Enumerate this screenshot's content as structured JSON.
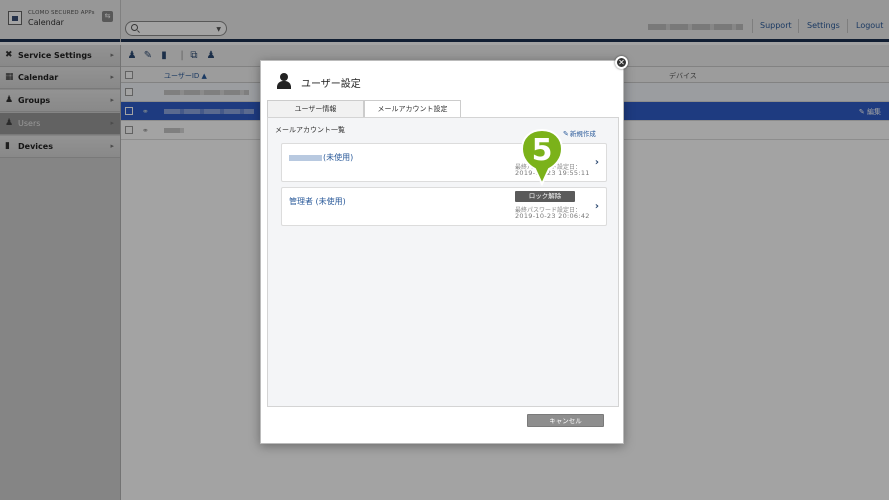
{
  "app": {
    "brand_sub": "CLOMO SECURED APPs",
    "brand_title": "Calendar",
    "search_placeholder": ""
  },
  "header": {
    "links": [
      "Support",
      "Settings",
      "Logout"
    ]
  },
  "sidebar": {
    "items": [
      {
        "label": "Service Settings",
        "icon": "wrench-icon"
      },
      {
        "label": "Calendar",
        "icon": "calendar-icon"
      },
      {
        "label": "Groups",
        "icon": "group-icon"
      },
      {
        "label": "Users",
        "icon": "user-icon",
        "active": true
      },
      {
        "label": "Devices",
        "icon": "device-icon"
      }
    ]
  },
  "table": {
    "columns": {
      "user_id": "ユーザーID ▲",
      "device": "デバイス"
    },
    "edit_label": "✎ 編集"
  },
  "modal": {
    "title": "ユーザー設定",
    "tabs": [
      "ユーザー情報",
      "メールアカウント設定"
    ],
    "active_tab": 1,
    "list_title": "メールアカウント一覧",
    "new_link": "新規作成",
    "accounts": [
      {
        "name_suffix": "(未使用)",
        "meta_label": "最終パスワード設定日：",
        "meta_value": "2019-10-23 19:55:11"
      },
      {
        "name": "管理者 (未使用)",
        "unlock_label": "ロック解除",
        "meta_label": "最終パスワード設定日：",
        "meta_value": "2019-10-23 20:06:42"
      }
    ],
    "cancel_label": "キャンセル"
  },
  "annotation": {
    "step_number": "5",
    "marker_color": "#7bb21a"
  }
}
